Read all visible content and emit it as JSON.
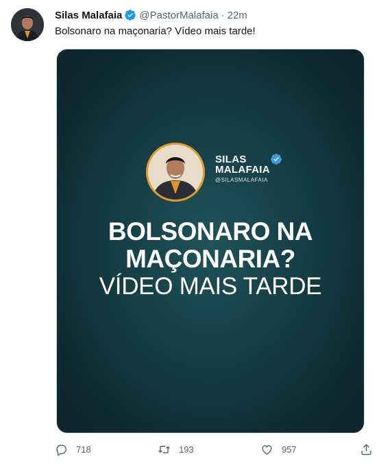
{
  "tweet": {
    "author_name": "Silas Malafaia",
    "handle": "@PastorMalafaia",
    "separator": "·",
    "time": "22m",
    "text": "Bolsonaro na maçonaria? Vídeo mais tarde!",
    "verified_color": "#1d9bf0"
  },
  "media": {
    "name_line1": "SILAS",
    "name_line2": "MALAFAIA",
    "handle": "@SILASMALAFAIA",
    "headline_line1": "BOLSONARO NA",
    "headline_line2": "MAÇONARIA?",
    "subline": "VÍDEO MAIS TARDE",
    "ring_color": "#e39a2c"
  },
  "actions": {
    "replies": "718",
    "retweets": "193",
    "likes": "957",
    "icons": [
      "reply-icon",
      "retweet-icon",
      "like-icon",
      "share-icon"
    ]
  }
}
